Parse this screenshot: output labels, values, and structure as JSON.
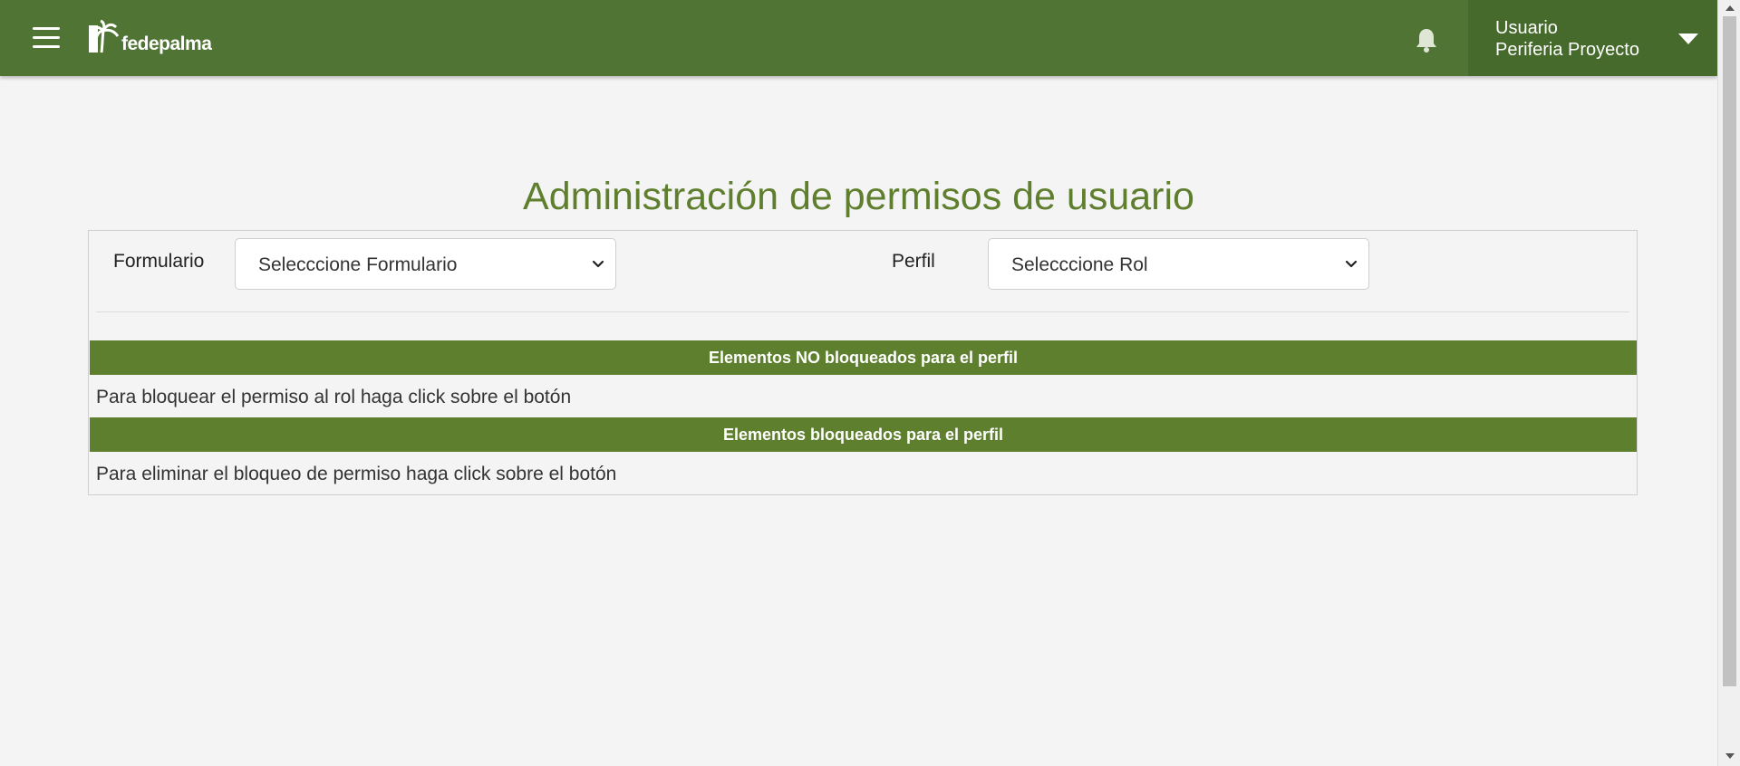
{
  "header": {
    "menu_icon": "hamburger-icon",
    "logo_text": "fedepalma",
    "logo_icon": "palm-tree-logo",
    "notification_icon": "bell-icon",
    "user": {
      "name": "Usuario",
      "role": "Periferia Proyecto",
      "dropdown_icon": "caret-down-icon"
    },
    "colors": {
      "bar": "#4f7433",
      "user_menu": "#456a2b"
    }
  },
  "page": {
    "title": "Administración de permisos de usuario",
    "title_color": "#5f7f2f"
  },
  "filters": {
    "form_label": "Formulario",
    "form_select_value": "Selecccione Formulario",
    "profile_label": "Perfil",
    "profile_select_value": "Selecccione Rol"
  },
  "sections": {
    "unblocked": {
      "header": "Elementos NO bloqueados para el perfil",
      "note": "Para bloquear el permiso al rol haga click sobre el botón"
    },
    "blocked": {
      "header": "Elementos bloqueados para el perfil",
      "note": "Para eliminar el bloqueo de permiso haga click sobre el botón"
    },
    "header_color": "#5e7f2d"
  }
}
